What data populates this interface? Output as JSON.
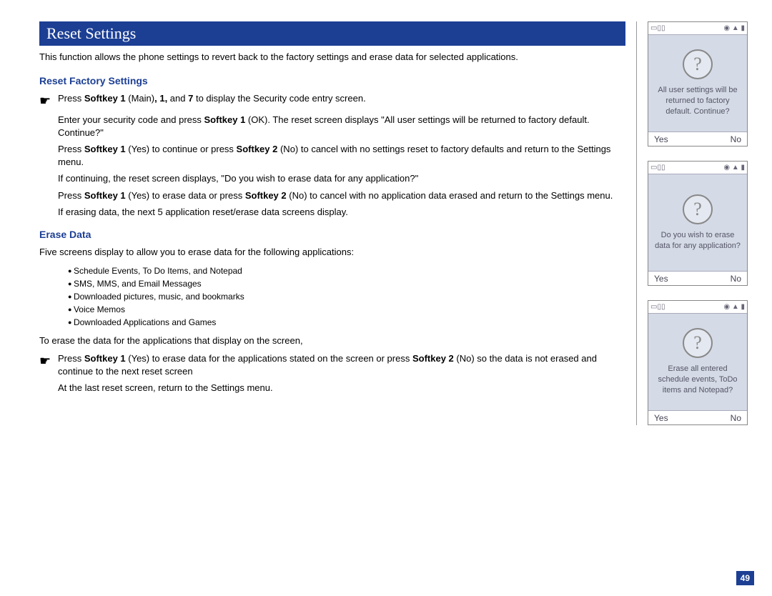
{
  "title": "Reset Settings",
  "intro": "This function allows the phone settings to revert back to the factory settings and erase data for selected applications.",
  "section1": {
    "heading": "Reset Factory Settings",
    "step1_pre": "Press ",
    "step1_b1": "Softkey 1",
    "step1_mid1": " (Main)",
    "step1_b2": ", 1,",
    "step1_mid2": " and ",
    "step1_b3": "7",
    "step1_post": " to display the Security code entry screen.",
    "ind1a": "Enter your security code and press ",
    "ind1a_b": "Softkey 1",
    "ind1a2": " (OK). The reset screen displays \"All user settings will be returned to factory default. Continue?\"",
    "ind2a": "Press ",
    "ind2a_b1": "Softkey 1",
    "ind2a_m": " (Yes) to continue or press ",
    "ind2a_b2": "Softkey 2",
    "ind2a_p": " (No) to cancel with no settings reset to factory defaults and return to the Settings menu.",
    "ind3": "If continuing, the reset screen displays, \"Do you wish to erase data for any application?\"",
    "ind4a": "Press ",
    "ind4a_b1": "Softkey 1",
    "ind4a_m": " (Yes) to erase data or press ",
    "ind4a_b2": "Softkey 2",
    "ind4a_p": " (No) to cancel with no application data erased and return to the Settings menu.",
    "ind5": "If erasing data, the next 5 application reset/erase data screens display."
  },
  "section2": {
    "heading": "Erase Data",
    "para1": "Five screens display to allow you to erase data for the following applications:",
    "bullets": [
      "Schedule Events, To Do Items, and Notepad",
      "SMS, MMS, and Email Messages",
      "Downloaded pictures, music, and bookmarks",
      "Voice Memos",
      "Downloaded Applications and Games"
    ],
    "para2": "To erase the data for the applications that display on the screen,",
    "step_pre": "Press ",
    "step_b1": "Softkey 1",
    "step_mid": " (Yes) to erase data for the applications stated on the screen or press ",
    "step_b2": "Softkey 2",
    "step_post": " (No) so the data is not erased and continue to the next reset screen",
    "ind_last": "At the last reset screen, return to the Settings menu."
  },
  "phones": [
    {
      "msg": "All user settings will be returned to factory default. Continue?",
      "left": "Yes",
      "right": "No"
    },
    {
      "msg": "Do you wish to erase data for any application?",
      "left": "Yes",
      "right": "No"
    },
    {
      "msg": "Erase all entered schedule events, ToDo items and Notepad?",
      "left": "Yes",
      "right": "No"
    }
  ],
  "status_left": "▭▯▯",
  "status_right": "◉ ▲ ▮",
  "page_number": "49"
}
